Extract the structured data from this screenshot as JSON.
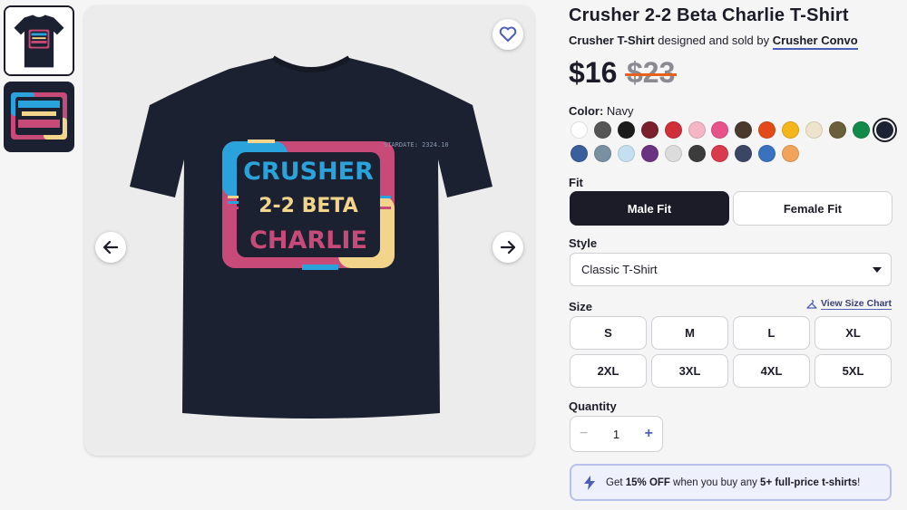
{
  "product": {
    "title": "Crusher 2-2 Beta Charlie T-Shirt",
    "type_label": "Crusher T-Shirt",
    "designed_text": "designed and sold by",
    "artist": "Crusher Convo",
    "price_now": "$16",
    "price_was": "$23"
  },
  "design": {
    "line1": "CRUSHER",
    "line2": "2-2 BETA",
    "line3": "CHARLIE",
    "stardate": "STARDATE: 2324.10"
  },
  "color": {
    "label": "Color:",
    "selected": "Navy",
    "swatches": [
      "#ffffff",
      "#555555",
      "#1b1b1b",
      "#7a1f2b",
      "#d0303a",
      "#f4b6c4",
      "#e8528b",
      "#4a3a2e",
      "#e34a1a",
      "#f5b51b",
      "#eee4cc",
      "#6b5e3a",
      "#128a4a",
      "#1d2233",
      "#3a5f9c",
      "#7890a0",
      "#c4e0f0",
      "#6a3280",
      "#dcdcdc",
      "#3c3c3c",
      "#d93a4c",
      "#3b4664",
      "#3a72c0",
      "#f2a45c"
    ]
  },
  "fit": {
    "label": "Fit",
    "options": [
      "Male Fit",
      "Female Fit"
    ]
  },
  "style": {
    "label": "Style",
    "selected": "Classic T-Shirt"
  },
  "size": {
    "label": "Size",
    "chart_link": "View Size Chart",
    "options": [
      "S",
      "M",
      "L",
      "XL",
      "2XL",
      "3XL",
      "4XL",
      "5XL"
    ]
  },
  "quantity": {
    "label": "Quantity",
    "value": "1",
    "minus": "−",
    "plus": "+"
  },
  "promo": {
    "prefix": "Get ",
    "discount": "15% OFF",
    "middle": " when you buy any ",
    "qualifier": "5+ full-price t-shirts",
    "suffix": "!"
  },
  "colors": {
    "navy": "#1b2130",
    "blue": "#2aa3dc",
    "pink": "#c84a78",
    "cream": "#f2d58a",
    "accent": "#4c5eb8"
  }
}
